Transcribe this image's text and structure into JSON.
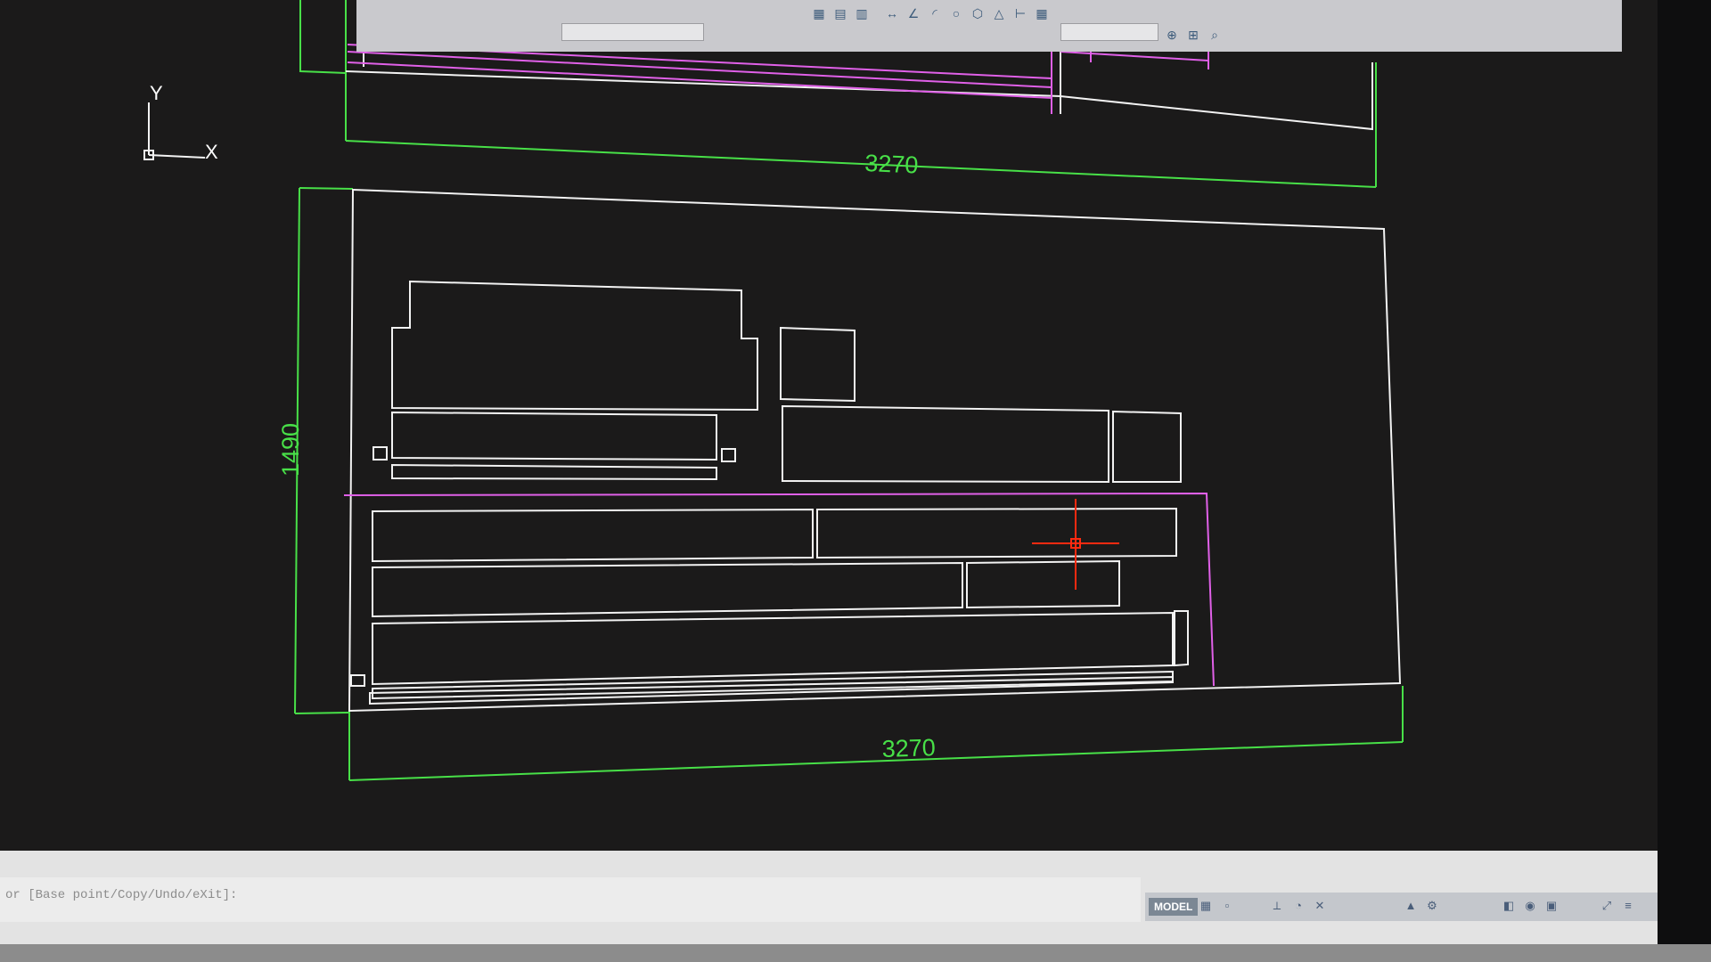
{
  "colors": {
    "background": "#1b1a1a",
    "geometry": "#f2f2f2",
    "dimension": "#48e048",
    "magenta": "#e060e8",
    "crosshair": "#ff2a10"
  },
  "ucs": {
    "y_label": "Y",
    "x_label": "X"
  },
  "dimensions": {
    "top_width": "3270",
    "bottom_width": "3270",
    "height": "1490"
  },
  "toolbar": {
    "icons": [
      "layer-icon",
      "layer-state-icon",
      "match-layer-icon",
      "dim-linear-icon",
      "dim-angular-icon",
      "dim-radius-icon",
      "circle-icon",
      "polygon-icon",
      "triangle-icon",
      "dim-baseline-icon",
      "table-icon",
      "zoom-window-icon",
      "zoom-extents-icon",
      "zoom-icon"
    ]
  },
  "command_line": {
    "prompt": "or [Base point/Copy/Undo/eXit]:"
  },
  "status_bar": {
    "model_label": "MODEL",
    "icons": [
      "grid-icon",
      "snap-icon",
      "ortho-icon",
      "polar-icon",
      "osnap-icon",
      "annotation-icon",
      "workspace-icon",
      "lock-icon",
      "isolate-icon",
      "hardware-icon",
      "fullscreen-icon",
      "customize-icon"
    ]
  }
}
